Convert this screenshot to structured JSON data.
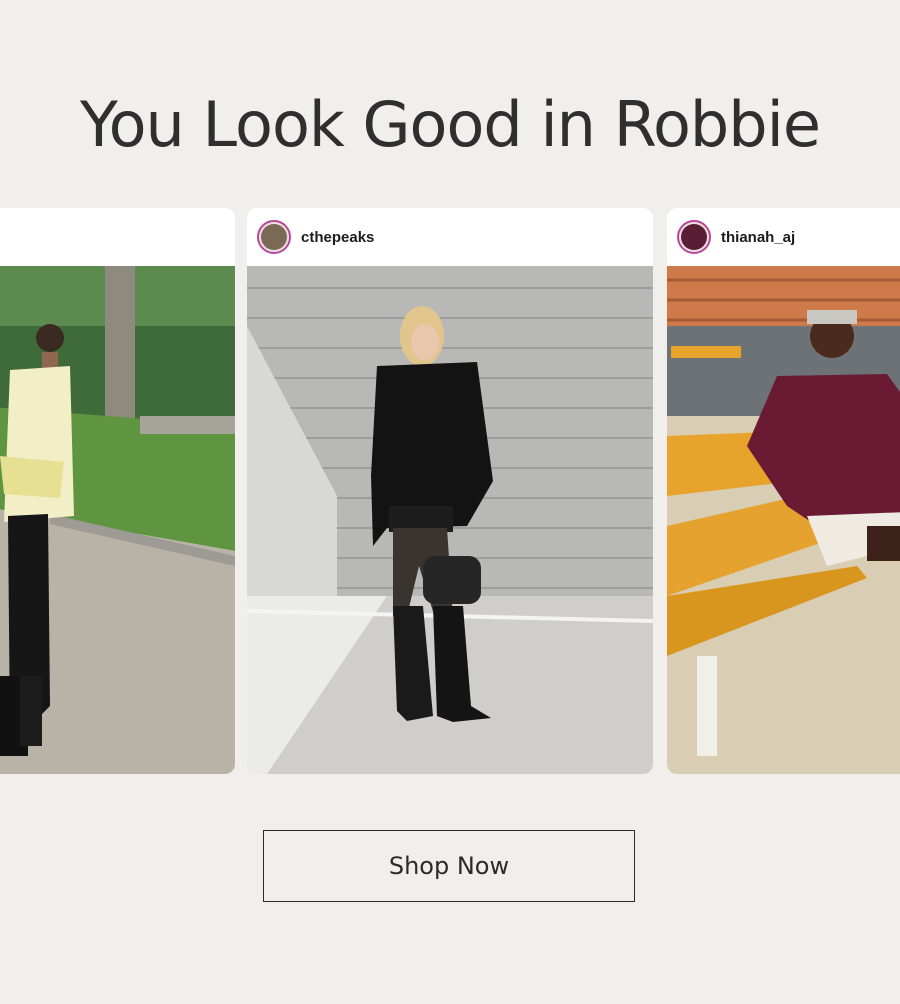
{
  "headline": "You Look Good in Robbie",
  "cards": [
    {
      "handle": ""
    },
    {
      "handle": "cthepeaks"
    },
    {
      "handle": "thianah_aj"
    }
  ],
  "cta": {
    "label": "Shop Now"
  },
  "colors": {
    "background": "#f0efeb",
    "text": "#2b2b2b",
    "avatar_ring": "#b8479d"
  }
}
